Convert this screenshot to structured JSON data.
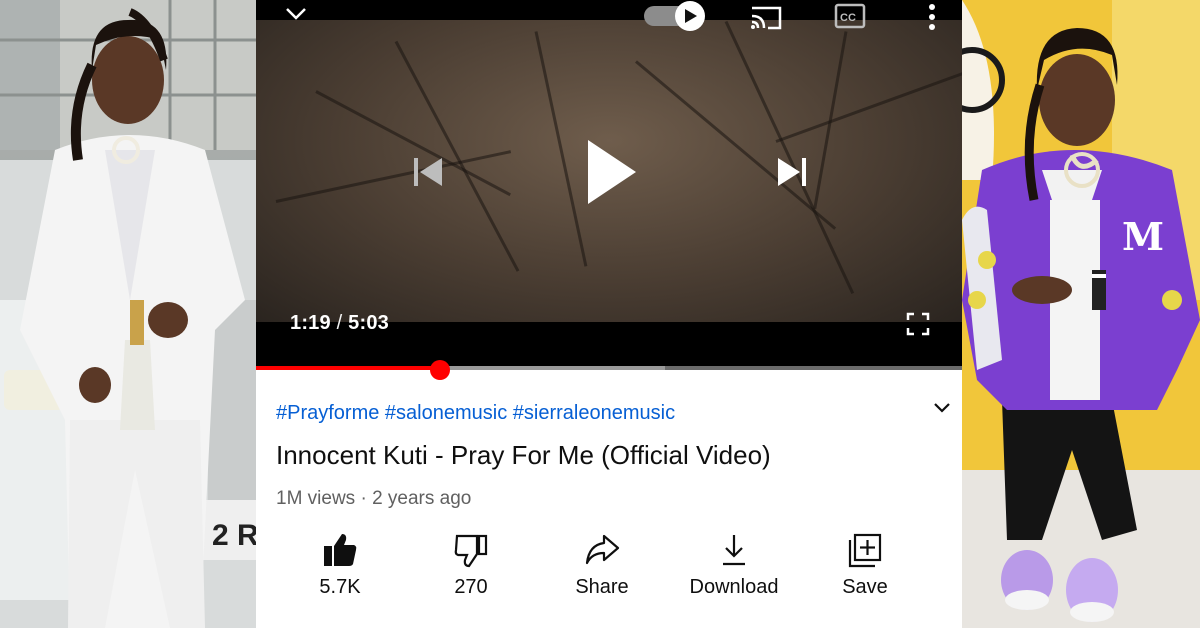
{
  "player": {
    "current_time": "1:19",
    "separator": "/",
    "duration": "5:03",
    "progress_fraction": 0.26,
    "buffered_fraction": 0.58
  },
  "video": {
    "hashtags": "#Prayforme #salonemusic #sierraleonemusic",
    "title": "Innocent Kuti - Pray For Me (Official Video)",
    "views": "1M views",
    "age": "2 years ago"
  },
  "actions": [
    {
      "icon": "thumbs-up-icon",
      "label": "5.7K"
    },
    {
      "icon": "thumbs-down-icon",
      "label": "270"
    },
    {
      "icon": "share-icon",
      "label": "Share"
    },
    {
      "icon": "download-icon",
      "label": "Download"
    },
    {
      "icon": "save-playlist-icon",
      "label": "Save"
    }
  ],
  "colors": {
    "accent_red": "#ff0000",
    "hashtag_blue": "#065fd4",
    "title_text": "#0f0f0f",
    "meta_text": "#606060",
    "left_suit": "#f2f2f2",
    "right_jacket": "#7b3fd0",
    "right_background": "#f1c63a"
  }
}
